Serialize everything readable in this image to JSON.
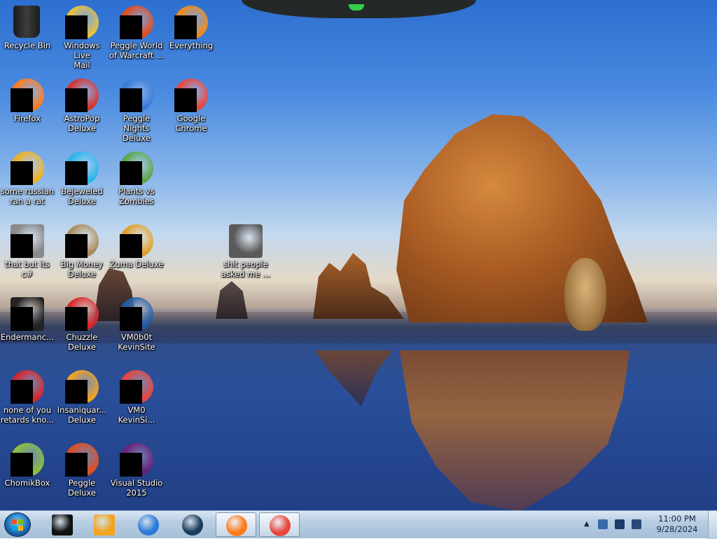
{
  "desktop": {
    "icons": [
      {
        "name": "Recycle Bin",
        "label": "Recycle Bin",
        "icon": "recycle-bin-icon",
        "color": "#1a1a1a",
        "redacted": false
      },
      {
        "name": "Windows Live Mail",
        "label": "Windows Live\nMail",
        "icon": "mail-icon",
        "color": "#e8c23a",
        "redacted": true
      },
      {
        "name": "Peggle World of Warcraft",
        "label": "Peggle World\nof Warcraft ...",
        "icon": "peggle-icon",
        "color": "#e24d1c",
        "redacted": true
      },
      {
        "name": "Everything",
        "label": "Everything",
        "icon": "search-app-icon",
        "color": "#f08a1a",
        "redacted": true
      },
      {
        "name": "Firefox",
        "label": "Firefox",
        "icon": "firefox-icon",
        "color": "#ff7a1a",
        "redacted": true
      },
      {
        "name": "AstroPop Deluxe",
        "label": "AstroPop\nDeluxe",
        "icon": "astropop-icon",
        "color": "#d8322b",
        "redacted": true
      },
      {
        "name": "Peggle Nights Deluxe",
        "label": "Peggle Nights\nDeluxe",
        "icon": "peggle-nights-icon",
        "color": "#3a7ad8",
        "redacted": true
      },
      {
        "name": "Google Chrome",
        "label": "Google\nChrome",
        "icon": "chrome-icon",
        "color": "#e8453c",
        "redacted": true
      },
      {
        "name": "some russian ran a rat",
        "label": "some russian\nran a rat",
        "icon": "app-icon",
        "color": "#f2b01e",
        "redacted": true
      },
      {
        "name": "Bejeweled Deluxe",
        "label": "Bejeweled\nDeluxe",
        "icon": "bejeweled-icon",
        "color": "#29b6e8",
        "redacted": true
      },
      {
        "name": "Plants vs Zombies",
        "label": "Plants vs\nZombies",
        "icon": "plants-vs-zombies-icon",
        "color": "#5aa64a",
        "redacted": true
      },
      {
        "name": "that but its c#",
        "label": "that but its c#",
        "icon": "shortcut-icon",
        "color": "#8a8a8a",
        "redacted": true
      },
      {
        "name": "Big Money Deluxe",
        "label": "Big Money\nDeluxe",
        "icon": "money-bag-icon",
        "color": "#a88a5a",
        "redacted": true
      },
      {
        "name": "Zuma Deluxe",
        "label": "Zuma Deluxe",
        "icon": "zuma-icon",
        "color": "#e0a02a",
        "redacted": true
      },
      {
        "name": "shit people asked me",
        "label": "shit people\nasked me ...",
        "icon": "folder-icon",
        "color": "#5a5a5a",
        "redacted": false
      },
      {
        "name": "Endermanch",
        "label": "Endermanc...",
        "icon": "terminal-icon",
        "color": "#222222",
        "redacted": true
      },
      {
        "name": "Chuzzle Deluxe",
        "label": "Chuzzle\nDeluxe",
        "icon": "chuzzle-icon",
        "color": "#d8262a",
        "redacted": true
      },
      {
        "name": "VM0b0t KevinSite",
        "label": "VM0b0t\nKevinSite",
        "icon": "site-icon",
        "color": "#1c5aa8",
        "redacted": true
      },
      {
        "name": "none of you retards know",
        "label": "none of you\nretards kno...",
        "icon": "app-icon",
        "color": "#d8262a",
        "redacted": true
      },
      {
        "name": "Insaniquarium Deluxe",
        "label": "Insaniquar...\nDeluxe",
        "icon": "fish-icon",
        "color": "#f2a41e",
        "redacted": true
      },
      {
        "name": "VM0 KevinSite",
        "label": "VM0\nKevinSi...",
        "icon": "chrome-icon",
        "color": "#e8453c",
        "redacted": true
      },
      {
        "name": "ChomikBox",
        "label": "ChomikBox",
        "icon": "chomikbox-icon",
        "color": "#8ac23a",
        "redacted": true
      },
      {
        "name": "Peggle Deluxe",
        "label": "Peggle Deluxe",
        "icon": "peggle-icon",
        "color": "#e24d1c",
        "redacted": true
      },
      {
        "name": "Visual Studio 2015",
        "label": "Visual Studio\n2015",
        "icon": "visual-studio-icon",
        "color": "#68217a",
        "redacted": true
      }
    ]
  },
  "taskbar": {
    "items": [
      {
        "name": "taskbar-app-black-box",
        "icon": "box-icon",
        "color": "#111111",
        "active": false
      },
      {
        "name": "taskbar-media-player",
        "icon": "media-player-icon",
        "color": "#f2a41e",
        "active": false
      },
      {
        "name": "taskbar-internet-explorer",
        "icon": "internet-explorer-icon",
        "color": "#2a7ad8",
        "active": false
      },
      {
        "name": "taskbar-globe-app",
        "icon": "globe-icon",
        "color": "#1b3b5a",
        "active": false
      },
      {
        "name": "taskbar-firefox",
        "icon": "firefox-icon",
        "color": "#ff7a1a",
        "active": true
      },
      {
        "name": "taskbar-chrome",
        "icon": "chrome-icon",
        "color": "#e8453c",
        "active": true
      }
    ],
    "tray_icons": [
      {
        "name": "action-center-icon",
        "color": "#3a6aa8"
      },
      {
        "name": "network-icon",
        "color": "#1c3a6a"
      },
      {
        "name": "volume-icon",
        "color": "#2a4a7a"
      }
    ],
    "clock": {
      "time": "11:00 PM",
      "date": "9/28/2024"
    }
  }
}
